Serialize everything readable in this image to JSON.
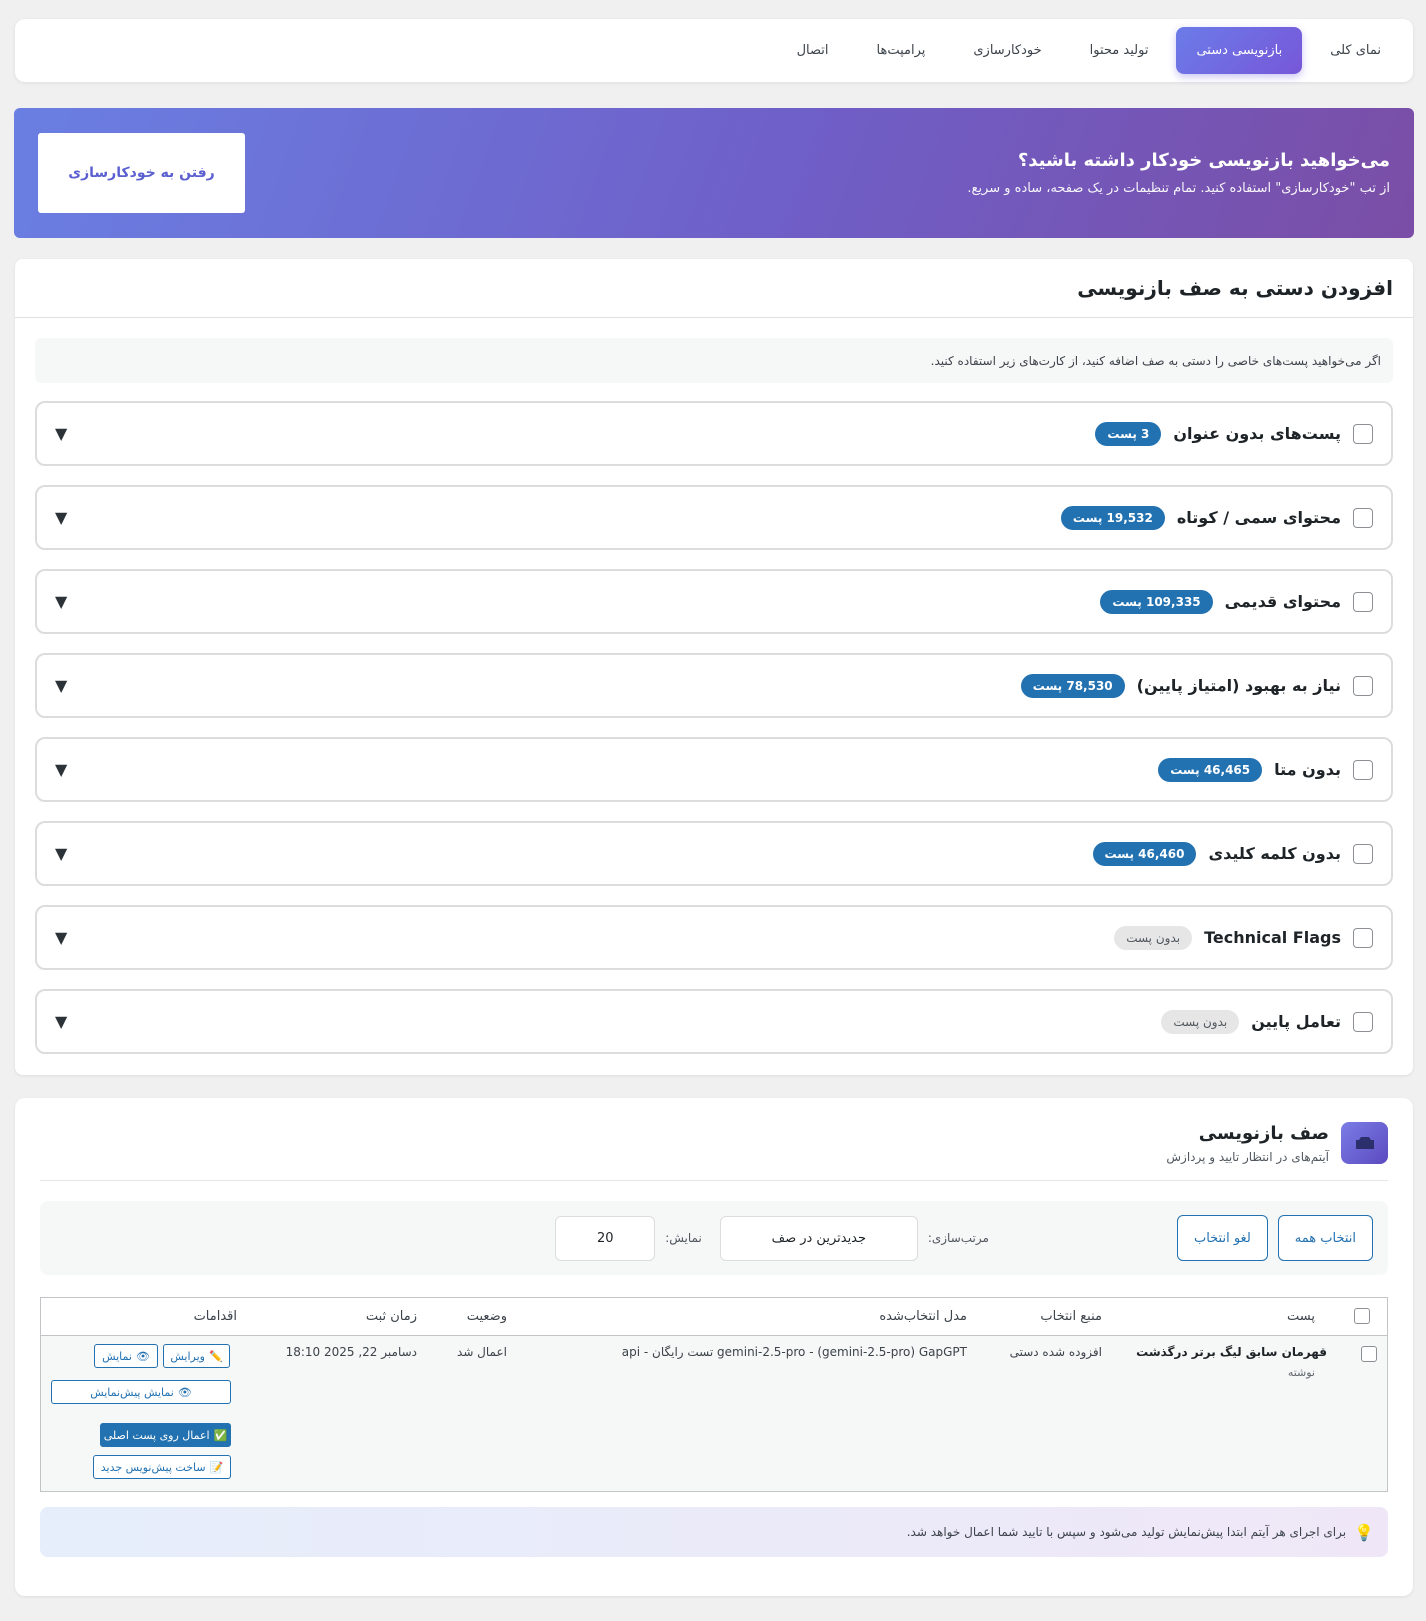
{
  "nav": {
    "tabs": [
      {
        "label": "نمای کلی"
      },
      {
        "label": "بازنویسی دستی"
      },
      {
        "label": "تولید محتوا"
      },
      {
        "label": "خودکارسازی"
      },
      {
        "label": "پرامپت‌ها"
      },
      {
        "label": "اتصال"
      }
    ],
    "active_index": 1
  },
  "banner": {
    "title": "می‌خواهید بازنویسی خودکار داشته باشید؟",
    "subtitle": "از تب \"خودکارسازی\" استفاده کنید. تمام تنظیمات در یک صفحه، ساده و سریع.",
    "button": "رفتن به خودکارسازی"
  },
  "manual": {
    "title": "افزودن دستی به صف بازنویسی",
    "notice": "اگر می‌خواهید پست‌های خاصی را دستی به صف اضافه کنید، از کارت‌های زیر استفاده کنید.",
    "arrow": "▼",
    "categories": [
      {
        "name": "پست‌های بدون عنوان",
        "badge": "3 پست",
        "empty": false
      },
      {
        "name": "محتوای سمی / کوتاه",
        "badge": "19,532 پست",
        "empty": false
      },
      {
        "name": "محتوای قدیمی",
        "badge": "109,335 پست",
        "empty": false
      },
      {
        "name": "نیاز به بهبود (امتیاز پایین)",
        "badge": "78,530 پست",
        "empty": false
      },
      {
        "name": "بدون متا",
        "badge": "46,465 پست",
        "empty": false
      },
      {
        "name": "بدون کلمه کلیدی",
        "badge": "46,460 پست",
        "empty": false
      },
      {
        "name": "Technical Flags",
        "badge": "بدون پست",
        "empty": true
      },
      {
        "name": "تعامل پایین",
        "badge": "بدون پست",
        "empty": true
      }
    ]
  },
  "queue": {
    "title": "صف بازنویسی",
    "subtitle": "آیتم‌های در انتظار تایید و پردازش",
    "select_all": "انتخاب همه",
    "deselect": "لغو انتخاب",
    "sort_label": "مرتب‌سازی:",
    "sort_value": "جدیدترین در صف",
    "show_label": "نمایش:",
    "show_value": "20",
    "headers": {
      "post": "پست",
      "source": "منبع انتخاب",
      "model": "مدل انتخاب‌شده",
      "status": "وضعیت",
      "time": "زمان ثبت",
      "actions": "اقدامات"
    },
    "rows": [
      {
        "post_title": "قهرمان سابق لیگ برتر درگذشت",
        "post_type": "نوشته",
        "source": "افزوده شده دستی",
        "model": "gemini-2.5-pro - (gemini-2.5-pro) GapGPT تست رایگان - api",
        "status": "اعمال شد",
        "time": "دسامبر 22, 2025 18:10",
        "actions": {
          "edit": "ویرایش",
          "view": "نمایش",
          "preview": "نمایش پیش‌نمایش",
          "apply": "اعمال روی پست اصلی",
          "draft": "ساخت پیش‌نویس جدید"
        }
      }
    ],
    "tip": "برای اجرای هر آیتم ابتدا پیش‌نمایش تولید می‌شود و سپس با تایید شما اعمال خواهد شد."
  }
}
